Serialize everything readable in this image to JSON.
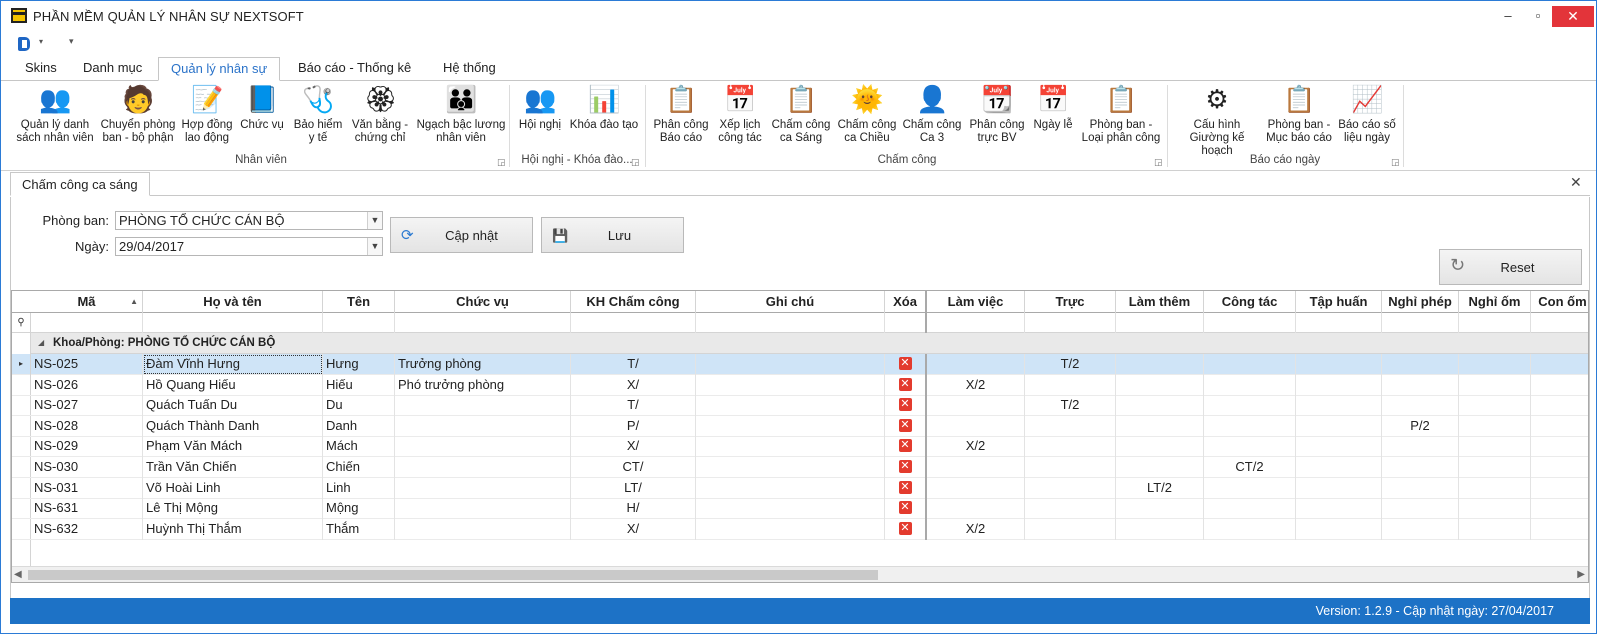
{
  "window": {
    "title": "PHẦN MỀM QUẢN LÝ NHÂN SỰ NEXTSOFT",
    "min": "–",
    "max": "▫",
    "close": "✕"
  },
  "qat": {
    "dropdown": "▾",
    "customize": "▾"
  },
  "ribbon_tabs": [
    "Skins",
    "Danh mục",
    "Quản lý nhân sự",
    "Báo cáo - Thống kê",
    "Hệ thống"
  ],
  "ribbon": {
    "buttons": [
      {
        "label": "Quản lý danh sách nhân viên",
        "icon": "people-icon",
        "glyph": "👥"
      },
      {
        "label": "Chuyển phòng ban - bộ phận",
        "icon": "transfer-icon",
        "glyph": "🧑"
      },
      {
        "label": "Hợp đồng lao động",
        "icon": "contract-icon",
        "glyph": "📝"
      },
      {
        "label": "Chức vụ",
        "icon": "position-icon",
        "glyph": "📘"
      },
      {
        "label": "Bảo hiểm y tế",
        "icon": "stethoscope-icon",
        "glyph": "🩺"
      },
      {
        "label": "Văn bằng - chứng chỉ",
        "icon": "certificate-icon",
        "glyph": "🏵"
      },
      {
        "label": "Ngạch bậc lương nhân viên",
        "icon": "salary-grade-icon",
        "glyph": "👪"
      },
      {
        "label": "Hội nghị",
        "icon": "conference-icon",
        "glyph": "👥"
      },
      {
        "label": "Khóa đào tạo",
        "icon": "training-icon",
        "glyph": "📊"
      },
      {
        "label": "Phân công Báo cáo",
        "icon": "report-assign-icon",
        "glyph": "📋"
      },
      {
        "label": "Xếp lịch công tác",
        "icon": "calendar-icon",
        "glyph": "📅"
      },
      {
        "label": "Chấm công ca Sáng",
        "icon": "morning-shift-icon",
        "glyph": "📋"
      },
      {
        "label": "Chấm công ca Chiều",
        "icon": "afternoon-shift-icon",
        "glyph": "🌞"
      },
      {
        "label": "Chấm công Ca 3",
        "icon": "night-shift-icon",
        "glyph": "👤"
      },
      {
        "label": "Phân công trực BV",
        "icon": "duty-calendar-icon",
        "glyph": "📆"
      },
      {
        "label": "Ngày lễ",
        "icon": "holiday-icon",
        "glyph": "📅"
      },
      {
        "label": "Phòng ban - Loại phân công",
        "icon": "clipboard-icon",
        "glyph": "📋"
      },
      {
        "label": "Cấu hình Giường kế hoạch",
        "icon": "bed-config-icon",
        "glyph": "⚙"
      },
      {
        "label": "Phòng ban - Mục báo cáo",
        "icon": "dept-report-icon",
        "glyph": "📋"
      },
      {
        "label": "Báo cáo số liệu ngày",
        "icon": "daily-report-icon",
        "glyph": "📈"
      }
    ],
    "groups": [
      "Nhân viên",
      "Hội nghị - Khóa đào...",
      "Chấm công",
      "Báo cáo ngày"
    ],
    "launcher": "◲"
  },
  "doc_tab": {
    "label": "Chấm công ca sáng",
    "close": "✕"
  },
  "filters": {
    "dept_label": "Phòng ban:",
    "dept_value": "PHÒNG TỔ CHỨC CÁN BỘ",
    "date_label": "Ngày:",
    "date_value": "29/04/2017",
    "dd_glyph": "▼"
  },
  "buttons": {
    "update": "Cập nhật",
    "save": "Lưu",
    "reset": "Reset",
    "update_glyph": "⟳",
    "save_glyph": "💾",
    "reset_glyph": "↻"
  },
  "grid": {
    "columns": [
      "Mã",
      "Họ và tên",
      "Tên",
      "Chức vụ",
      "KH Chấm công",
      "Ghi chú",
      "Xóa",
      "Làm việc",
      "Trực",
      "Làm thêm",
      "Công tác",
      "Tập huấn",
      "Nghỉ phép",
      "Nghỉ ốm",
      "Con ốm"
    ],
    "sort_glyph": "▲",
    "filter_glyph": "⚲",
    "group_label": "Khoa/Phòng: PHÒNG TỔ CHỨC CÁN BỘ",
    "group_expand": "◢",
    "row_indicator": "▸",
    "delete_glyph": "✕",
    "rows": [
      {
        "ma": "NS-025",
        "ho_ten": "Đàm Vĩnh Hưng",
        "ten": "Hưng",
        "chuc_vu": "Trưởng phòng",
        "kh": "T/",
        "ghi_chu": "",
        "lam_viec": "",
        "truc": "T/2",
        "lam_them": "",
        "cong_tac": "",
        "tap_huan": "",
        "nghi_phep": "",
        "nghi_om": "",
        "con_om": ""
      },
      {
        "ma": "NS-026",
        "ho_ten": "Hồ Quang Hiếu",
        "ten": "Hiếu",
        "chuc_vu": "Phó trưởng phòng",
        "kh": "X/",
        "ghi_chu": "",
        "lam_viec": "X/2",
        "truc": "",
        "lam_them": "",
        "cong_tac": "",
        "tap_huan": "",
        "nghi_phep": "",
        "nghi_om": "",
        "con_om": ""
      },
      {
        "ma": "NS-027",
        "ho_ten": "Quách Tuấn Du",
        "ten": "Du",
        "chuc_vu": "",
        "kh": "T/",
        "ghi_chu": "",
        "lam_viec": "",
        "truc": "T/2",
        "lam_them": "",
        "cong_tac": "",
        "tap_huan": "",
        "nghi_phep": "",
        "nghi_om": "",
        "con_om": ""
      },
      {
        "ma": "NS-028",
        "ho_ten": "Quách Thành Danh",
        "ten": "Danh",
        "chuc_vu": "",
        "kh": "P/",
        "ghi_chu": "",
        "lam_viec": "",
        "truc": "",
        "lam_them": "",
        "cong_tac": "",
        "tap_huan": "",
        "nghi_phep": "P/2",
        "nghi_om": "",
        "con_om": ""
      },
      {
        "ma": "NS-029",
        "ho_ten": "Phạm Văn Mách",
        "ten": "Mách",
        "chuc_vu": "",
        "kh": "X/",
        "ghi_chu": "",
        "lam_viec": "X/2",
        "truc": "",
        "lam_them": "",
        "cong_tac": "",
        "tap_huan": "",
        "nghi_phep": "",
        "nghi_om": "",
        "con_om": ""
      },
      {
        "ma": "NS-030",
        "ho_ten": "Trần Văn Chiến",
        "ten": "Chiến",
        "chuc_vu": "",
        "kh": "CT/",
        "ghi_chu": "",
        "lam_viec": "",
        "truc": "",
        "lam_them": "",
        "cong_tac": "CT/2",
        "tap_huan": "",
        "nghi_phep": "",
        "nghi_om": "",
        "con_om": ""
      },
      {
        "ma": "NS-031",
        "ho_ten": "Võ Hoài Linh",
        "ten": "Linh",
        "chuc_vu": "",
        "kh": "LT/",
        "ghi_chu": "",
        "lam_viec": "",
        "truc": "",
        "lam_them": "LT/2",
        "cong_tac": "",
        "tap_huan": "",
        "nghi_phep": "",
        "nghi_om": "",
        "con_om": ""
      },
      {
        "ma": "NS-631",
        "ho_ten": "Lê Thị Mộng",
        "ten": "Mộng",
        "chuc_vu": "",
        "kh": "H/",
        "ghi_chu": "",
        "lam_viec": "",
        "truc": "",
        "lam_them": "",
        "cong_tac": "",
        "tap_huan": "",
        "nghi_phep": "",
        "nghi_om": "",
        "con_om": ""
      },
      {
        "ma": "NS-632",
        "ho_ten": "Huỳnh Thị Thắm",
        "ten": "Thắm",
        "chuc_vu": "",
        "kh": "X/",
        "ghi_chu": "",
        "lam_viec": "X/2",
        "truc": "",
        "lam_them": "",
        "cong_tac": "",
        "tap_huan": "",
        "nghi_phep": "",
        "nghi_om": "",
        "con_om": ""
      }
    ],
    "scroll_left": "◀",
    "scroll_right": "▶"
  },
  "status": {
    "text": "Version: 1.2.9 - Cập nhật ngày: 27/04/2017"
  }
}
